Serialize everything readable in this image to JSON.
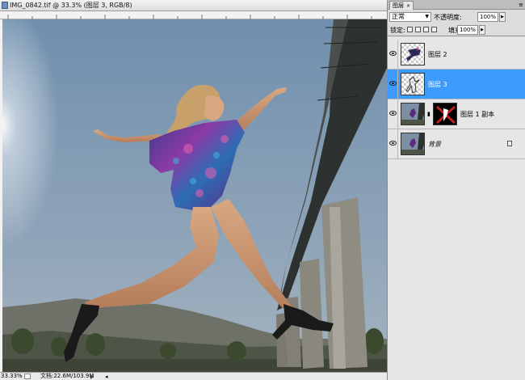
{
  "document": {
    "title": "IMG_0842.tif @ 33.3% (图层 3, RGB/8)",
    "status": {
      "zoom": "33.33%",
      "doc_info": "文档:22.6M/103.9M"
    }
  },
  "layers_panel": {
    "tab_label": "图层",
    "tab_close": "×",
    "menu_icon": "≡",
    "blend_mode": "正常",
    "opacity_label": "不透明度:",
    "opacity_value": "100%",
    "lock_label": "锁定:",
    "fill_label": "填充:",
    "fill_value": "100%",
    "layers": [
      {
        "name": "图层 2",
        "selected": false,
        "thumb": "dancer-silhouette"
      },
      {
        "name": "图层 3",
        "selected": true,
        "thumb": "transparent-figure"
      },
      {
        "name": "图层 1 副本",
        "selected": false,
        "thumb": "photo-with-mask"
      },
      {
        "name": "背景",
        "selected": false,
        "thumb": "photo",
        "locked": true
      }
    ]
  },
  "colors": {
    "selected_layer": "#3d9bff",
    "sky_top": "#6f8fad",
    "sky_bottom": "#a4b4c0"
  }
}
